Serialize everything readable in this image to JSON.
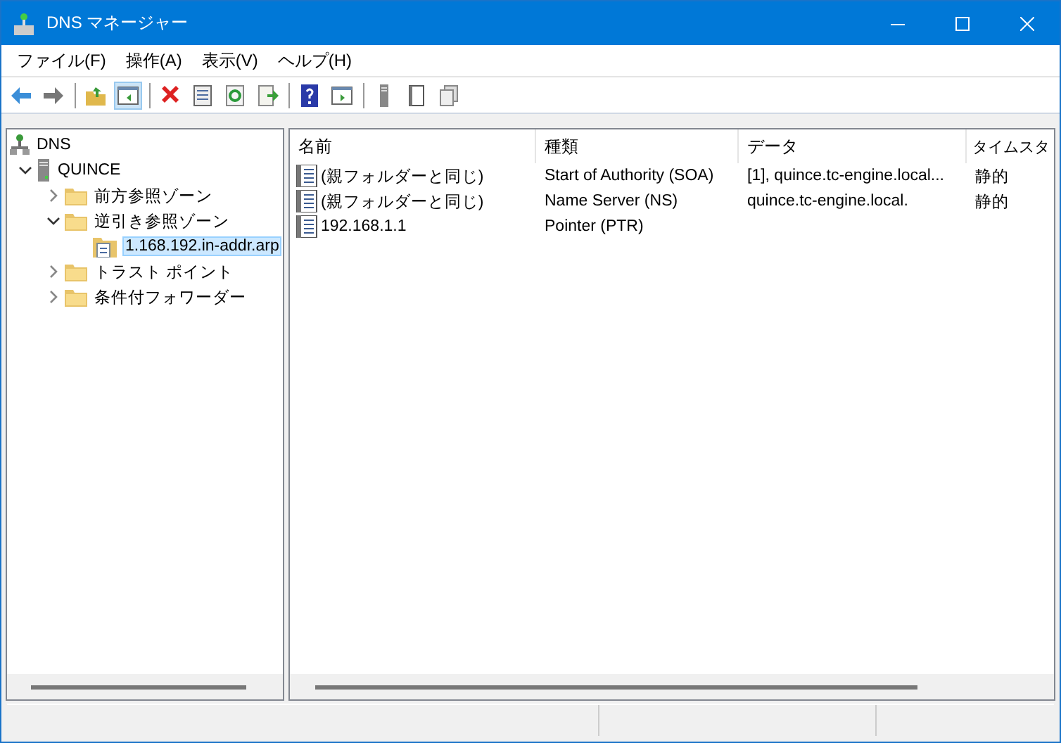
{
  "window": {
    "title": "DNS マネージャー"
  },
  "menu": [
    "ファイル(F)",
    "操作(A)",
    "表示(V)",
    "ヘルプ(H)"
  ],
  "toolbar": [
    {
      "pressed": false
    },
    {
      "pressed": false
    },
    {
      "pressed": false
    },
    {
      "pressed": true
    },
    {
      "pressed": false
    },
    {
      "pressed": false
    },
    {
      "pressed": false
    },
    {
      "pressed": false
    },
    {
      "pressed": false
    },
    {
      "pressed": false
    },
    {
      "pressed": false
    },
    {
      "pressed": false
    },
    {
      "pressed": false
    }
  ],
  "tree": [
    {
      "label": "DNS",
      "kind": "root",
      "selected": false,
      "children": [
        {
          "label": "QUINCE",
          "kind": "server",
          "selected": false,
          "expanded": true,
          "children": [
            {
              "label": "前方参照ゾーン",
              "kind": "folder",
              "selected": false,
              "expanded": false
            },
            {
              "label": "逆引き参照ゾーン",
              "kind": "folder",
              "selected": false,
              "expanded": true,
              "children": [
                {
                  "label": "1.168.192.in-addr.arp",
                  "kind": "zone",
                  "selected": true
                }
              ]
            },
            {
              "label": "トラスト ポイント",
              "kind": "folder",
              "selected": false,
              "expanded": false
            },
            {
              "label": "条件付フォワーダー",
              "kind": "folder",
              "selected": false,
              "expanded": false
            }
          ]
        }
      ]
    }
  ],
  "table": {
    "columns": [
      "名前",
      "種類",
      "データ",
      "タイムスタ"
    ],
    "rows": [
      [
        "(親フォルダーと同じ)",
        "Start of Authority (SOA)",
        "[1], quince.tc-engine.local...",
        "静的"
      ],
      [
        "(親フォルダーと同じ)",
        "Name Server (NS)",
        "quince.tc-engine.local.",
        "静的"
      ],
      [
        "192.168.1.1",
        "Pointer (PTR)",
        "",
        ""
      ]
    ]
  }
}
